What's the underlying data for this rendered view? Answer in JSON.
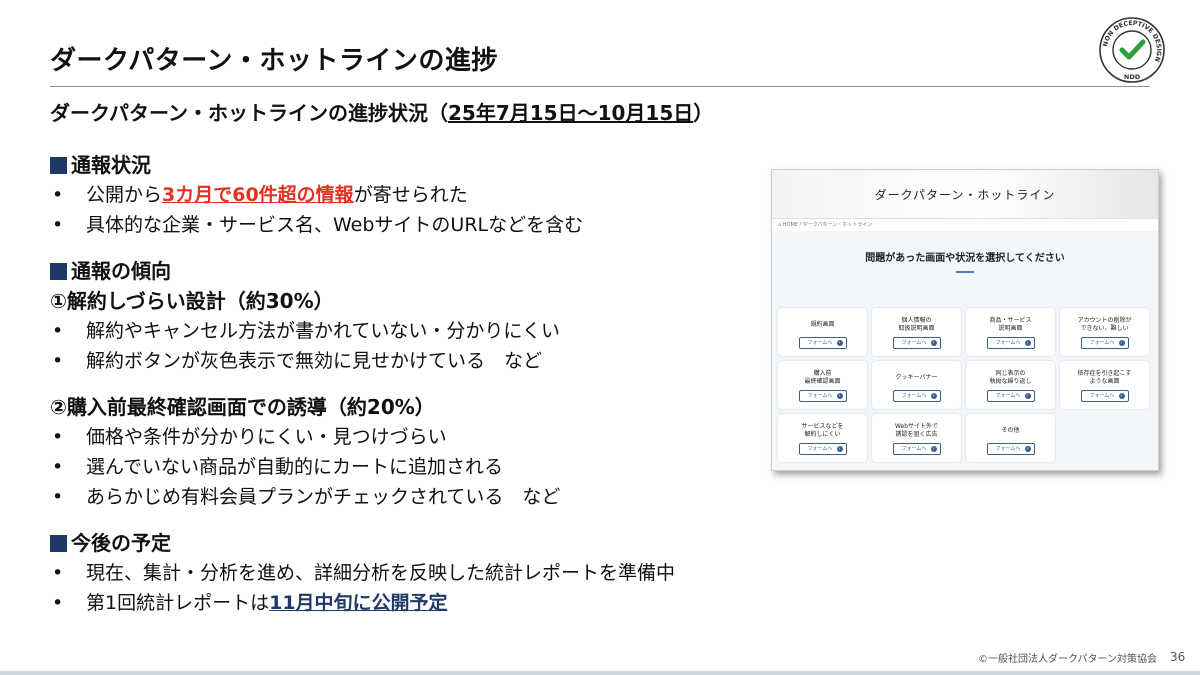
{
  "title": "ダークパターン・ホットラインの進捗",
  "logo": {
    "ring_text": "NON DECEPTIVE DESIGN",
    "center_text": "NDD",
    "check_color": "#2e9e3e"
  },
  "subtitle": {
    "main": "ダークパターン・ホットラインの進捗状況（",
    "period": "25年7月15日～10月15日",
    "close": "）"
  },
  "sections": {
    "report_status": {
      "heading": "通報状況",
      "b1_pre": "公開から",
      "b1_highlight": "3カ月で60件超の情報",
      "b1_post": "が寄せられた",
      "b2": "具体的な企業・サービス名、WebサイトのURLなどを含む"
    },
    "trend": {
      "heading": "通報の傾向",
      "sub1": "①解約しづらい設計（約30%）",
      "sub1_b1": "解約やキャンセル方法が書かれていない・分かりにくい",
      "sub1_b2": "解約ボタンが灰色表示で無効に見せかけている　など",
      "sub2": "②購入前最終確認画面での誘導（約20%）",
      "sub2_b1": "価格や条件が分かりにくい・見つけづらい",
      "sub2_b2": "選んでいない商品が自動的にカートに追加される",
      "sub2_b3": "あらかじめ有料会員プランがチェックされている　など"
    },
    "plan": {
      "heading": "今後の予定",
      "b1": "現在、集計・分析を進め、詳細分析を反映した統計レポートを準備中",
      "b2_pre": "第1回統計レポートは",
      "b2_highlight": "11月中旬に公開予定"
    }
  },
  "bullet_char": "•",
  "screenshot": {
    "header_title": "ダークパターン・ホットライン",
    "breadcrumb": "⌂ HOME / ダークパターン・ホットライン",
    "question": "問題があった画面や状況を選択してください",
    "button_label": "フォームへ",
    "cards": [
      "規約画面",
      "個人情報の\n取扱説明画面",
      "商品・サービス\n説明画面",
      "アカウントの削除が\nできない、難しい",
      "購入前\n最終確認画面",
      "クッキーバナー",
      "同じ表示の\n執拗な繰り返し",
      "依存症を引き起こす\nような画面",
      "サービスなどを\n解約しにくい",
      "Webサイト外で\n誘認を狙く広告",
      "その他"
    ]
  },
  "footer": "©一般社団法人ダークパターン対策協会",
  "page_number": "36",
  "colors": {
    "accent_red": "#e2321f",
    "accent_navy": "#1f3a68",
    "rule": "#7a9a90"
  }
}
